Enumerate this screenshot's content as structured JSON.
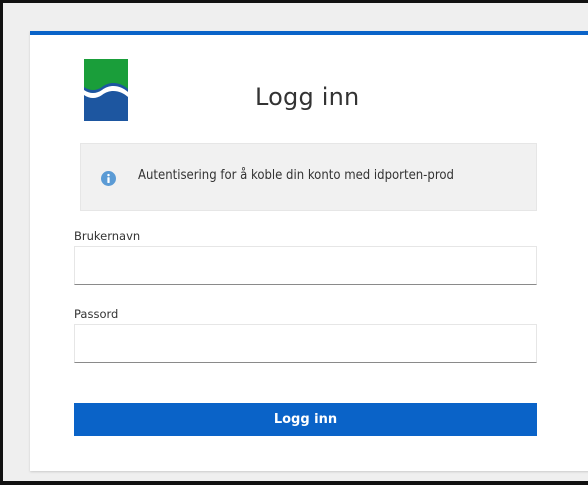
{
  "login": {
    "title": "Logg inn",
    "info_text": "Autentisering for å koble din konto med idporten-prod",
    "username_label": "Brukernavn",
    "username_value": "",
    "password_label": "Passord",
    "password_value": "",
    "submit_label": "Logg inn"
  },
  "icons": {
    "logo": "brand-logo-icon",
    "info": "info-icon"
  },
  "colors": {
    "accent": "#0a63c8",
    "logo_green": "#1a9e3a",
    "logo_blue": "#1d56a0",
    "info_icon": "#5b9bd5",
    "info_bg": "#f1f1f1",
    "frame": "#111111"
  }
}
